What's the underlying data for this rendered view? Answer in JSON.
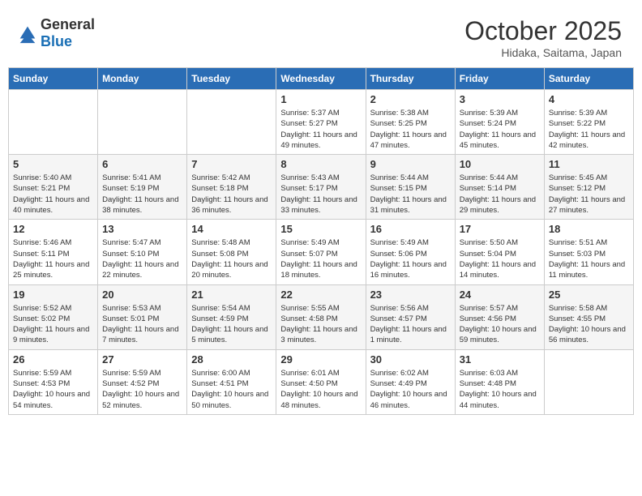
{
  "header": {
    "logo_general": "General",
    "logo_blue": "Blue",
    "month": "October 2025",
    "location": "Hidaka, Saitama, Japan"
  },
  "weekdays": [
    "Sunday",
    "Monday",
    "Tuesday",
    "Wednesday",
    "Thursday",
    "Friday",
    "Saturday"
  ],
  "weeks": [
    [
      {
        "day": "",
        "sunrise": "",
        "sunset": "",
        "daylight": ""
      },
      {
        "day": "",
        "sunrise": "",
        "sunset": "",
        "daylight": ""
      },
      {
        "day": "",
        "sunrise": "",
        "sunset": "",
        "daylight": ""
      },
      {
        "day": "1",
        "sunrise": "Sunrise: 5:37 AM",
        "sunset": "Sunset: 5:27 PM",
        "daylight": "Daylight: 11 hours and 49 minutes."
      },
      {
        "day": "2",
        "sunrise": "Sunrise: 5:38 AM",
        "sunset": "Sunset: 5:25 PM",
        "daylight": "Daylight: 11 hours and 47 minutes."
      },
      {
        "day": "3",
        "sunrise": "Sunrise: 5:39 AM",
        "sunset": "Sunset: 5:24 PM",
        "daylight": "Daylight: 11 hours and 45 minutes."
      },
      {
        "day": "4",
        "sunrise": "Sunrise: 5:39 AM",
        "sunset": "Sunset: 5:22 PM",
        "daylight": "Daylight: 11 hours and 42 minutes."
      }
    ],
    [
      {
        "day": "5",
        "sunrise": "Sunrise: 5:40 AM",
        "sunset": "Sunset: 5:21 PM",
        "daylight": "Daylight: 11 hours and 40 minutes."
      },
      {
        "day": "6",
        "sunrise": "Sunrise: 5:41 AM",
        "sunset": "Sunset: 5:19 PM",
        "daylight": "Daylight: 11 hours and 38 minutes."
      },
      {
        "day": "7",
        "sunrise": "Sunrise: 5:42 AM",
        "sunset": "Sunset: 5:18 PM",
        "daylight": "Daylight: 11 hours and 36 minutes."
      },
      {
        "day": "8",
        "sunrise": "Sunrise: 5:43 AM",
        "sunset": "Sunset: 5:17 PM",
        "daylight": "Daylight: 11 hours and 33 minutes."
      },
      {
        "day": "9",
        "sunrise": "Sunrise: 5:44 AM",
        "sunset": "Sunset: 5:15 PM",
        "daylight": "Daylight: 11 hours and 31 minutes."
      },
      {
        "day": "10",
        "sunrise": "Sunrise: 5:44 AM",
        "sunset": "Sunset: 5:14 PM",
        "daylight": "Daylight: 11 hours and 29 minutes."
      },
      {
        "day": "11",
        "sunrise": "Sunrise: 5:45 AM",
        "sunset": "Sunset: 5:12 PM",
        "daylight": "Daylight: 11 hours and 27 minutes."
      }
    ],
    [
      {
        "day": "12",
        "sunrise": "Sunrise: 5:46 AM",
        "sunset": "Sunset: 5:11 PM",
        "daylight": "Daylight: 11 hours and 25 minutes."
      },
      {
        "day": "13",
        "sunrise": "Sunrise: 5:47 AM",
        "sunset": "Sunset: 5:10 PM",
        "daylight": "Daylight: 11 hours and 22 minutes."
      },
      {
        "day": "14",
        "sunrise": "Sunrise: 5:48 AM",
        "sunset": "Sunset: 5:08 PM",
        "daylight": "Daylight: 11 hours and 20 minutes."
      },
      {
        "day": "15",
        "sunrise": "Sunrise: 5:49 AM",
        "sunset": "Sunset: 5:07 PM",
        "daylight": "Daylight: 11 hours and 18 minutes."
      },
      {
        "day": "16",
        "sunrise": "Sunrise: 5:49 AM",
        "sunset": "Sunset: 5:06 PM",
        "daylight": "Daylight: 11 hours and 16 minutes."
      },
      {
        "day": "17",
        "sunrise": "Sunrise: 5:50 AM",
        "sunset": "Sunset: 5:04 PM",
        "daylight": "Daylight: 11 hours and 14 minutes."
      },
      {
        "day": "18",
        "sunrise": "Sunrise: 5:51 AM",
        "sunset": "Sunset: 5:03 PM",
        "daylight": "Daylight: 11 hours and 11 minutes."
      }
    ],
    [
      {
        "day": "19",
        "sunrise": "Sunrise: 5:52 AM",
        "sunset": "Sunset: 5:02 PM",
        "daylight": "Daylight: 11 hours and 9 minutes."
      },
      {
        "day": "20",
        "sunrise": "Sunrise: 5:53 AM",
        "sunset": "Sunset: 5:01 PM",
        "daylight": "Daylight: 11 hours and 7 minutes."
      },
      {
        "day": "21",
        "sunrise": "Sunrise: 5:54 AM",
        "sunset": "Sunset: 4:59 PM",
        "daylight": "Daylight: 11 hours and 5 minutes."
      },
      {
        "day": "22",
        "sunrise": "Sunrise: 5:55 AM",
        "sunset": "Sunset: 4:58 PM",
        "daylight": "Daylight: 11 hours and 3 minutes."
      },
      {
        "day": "23",
        "sunrise": "Sunrise: 5:56 AM",
        "sunset": "Sunset: 4:57 PM",
        "daylight": "Daylight: 11 hours and 1 minute."
      },
      {
        "day": "24",
        "sunrise": "Sunrise: 5:57 AM",
        "sunset": "Sunset: 4:56 PM",
        "daylight": "Daylight: 10 hours and 59 minutes."
      },
      {
        "day": "25",
        "sunrise": "Sunrise: 5:58 AM",
        "sunset": "Sunset: 4:55 PM",
        "daylight": "Daylight: 10 hours and 56 minutes."
      }
    ],
    [
      {
        "day": "26",
        "sunrise": "Sunrise: 5:59 AM",
        "sunset": "Sunset: 4:53 PM",
        "daylight": "Daylight: 10 hours and 54 minutes."
      },
      {
        "day": "27",
        "sunrise": "Sunrise: 5:59 AM",
        "sunset": "Sunset: 4:52 PM",
        "daylight": "Daylight: 10 hours and 52 minutes."
      },
      {
        "day": "28",
        "sunrise": "Sunrise: 6:00 AM",
        "sunset": "Sunset: 4:51 PM",
        "daylight": "Daylight: 10 hours and 50 minutes."
      },
      {
        "day": "29",
        "sunrise": "Sunrise: 6:01 AM",
        "sunset": "Sunset: 4:50 PM",
        "daylight": "Daylight: 10 hours and 48 minutes."
      },
      {
        "day": "30",
        "sunrise": "Sunrise: 6:02 AM",
        "sunset": "Sunset: 4:49 PM",
        "daylight": "Daylight: 10 hours and 46 minutes."
      },
      {
        "day": "31",
        "sunrise": "Sunrise: 6:03 AM",
        "sunset": "Sunset: 4:48 PM",
        "daylight": "Daylight: 10 hours and 44 minutes."
      },
      {
        "day": "",
        "sunrise": "",
        "sunset": "",
        "daylight": ""
      }
    ]
  ]
}
